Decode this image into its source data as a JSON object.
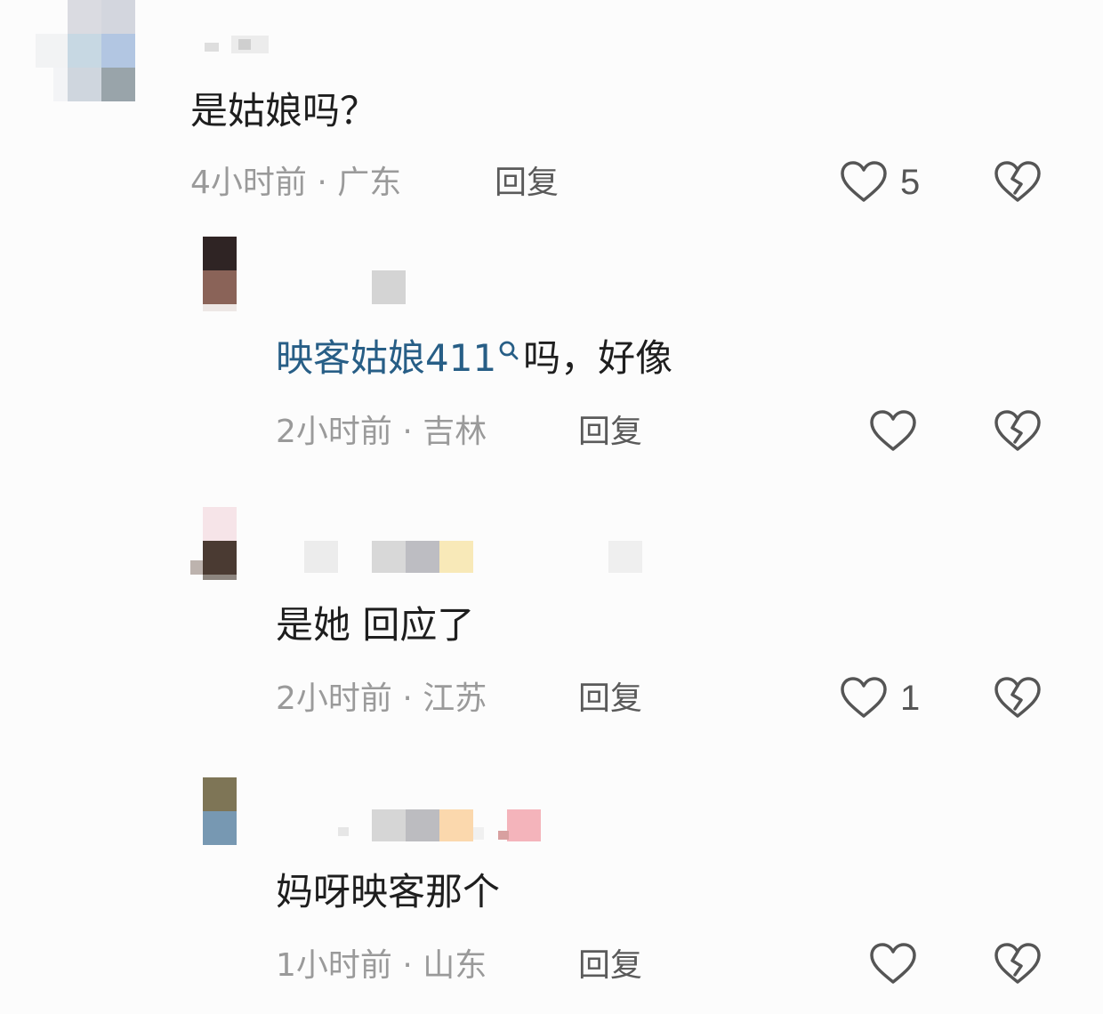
{
  "comments": [
    {
      "text": "是姑娘吗？",
      "time": "4小时前",
      "separator": "·",
      "location": "广东",
      "reply_label": "回复",
      "likes": "5"
    },
    {
      "mention": "映客姑娘411",
      "text_after": "吗，好像",
      "time": "2小时前",
      "separator": "·",
      "location": "吉林",
      "reply_label": "回复",
      "likes": ""
    },
    {
      "text": "是她 回应了",
      "time": "2小时前",
      "separator": "·",
      "location": "江苏",
      "reply_label": "回复",
      "likes": "1"
    },
    {
      "text": "妈呀映客那个",
      "time": "1小时前",
      "separator": "·",
      "location": "山东",
      "reply_label": "回复",
      "likes": ""
    }
  ],
  "icons": {
    "like": "heart-outline-icon",
    "dislike": "broken-heart-icon",
    "mention_search": "search-icon"
  },
  "colors": {
    "mention": "#275e86",
    "text": "#1e1e1e",
    "meta": "#9a9a9a",
    "reply": "#5a5a5a",
    "icon": "#555555"
  }
}
